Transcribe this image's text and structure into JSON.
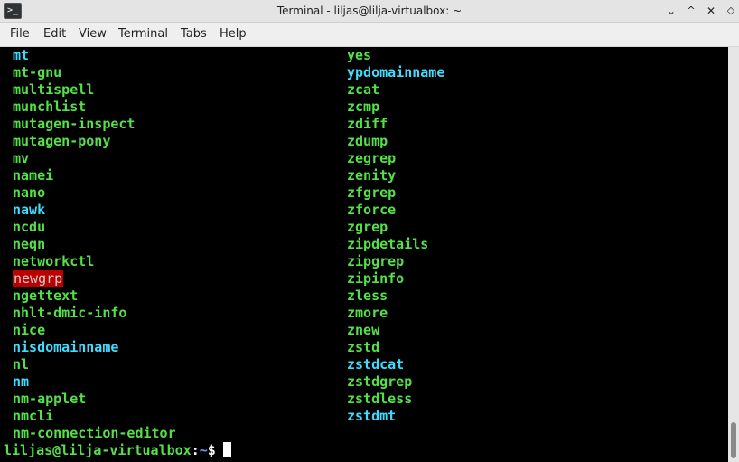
{
  "window": {
    "title": "Terminal - liljas@lilja-virtualbox: ~",
    "app_icon": "terminal-icon",
    "app_icon_glyph": ">_",
    "controls": {
      "minimize": "⌄",
      "maximize": "^",
      "close": "✕",
      "extra": "◇"
    }
  },
  "menu": [
    "File",
    "Edit",
    "View",
    "Terminal",
    "Tabs",
    "Help"
  ],
  "colors": {
    "green": "#55e04a",
    "cyan": "#40dcff",
    "highlight_bg": "#bb0000",
    "path": "#5aa0ff"
  },
  "terminal": {
    "col1": [
      {
        "text": "mt",
        "color": "cyan"
      },
      {
        "text": "mt-gnu",
        "color": "green"
      },
      {
        "text": "multispell",
        "color": "green"
      },
      {
        "text": "munchlist",
        "color": "green"
      },
      {
        "text": "mutagen-inspect",
        "color": "green"
      },
      {
        "text": "mutagen-pony",
        "color": "green"
      },
      {
        "text": "mv",
        "color": "green"
      },
      {
        "text": "namei",
        "color": "green"
      },
      {
        "text": "nano",
        "color": "green"
      },
      {
        "text": "nawk",
        "color": "cyan"
      },
      {
        "text": "ncdu",
        "color": "green"
      },
      {
        "text": "neqn",
        "color": "green"
      },
      {
        "text": "networkctl",
        "color": "green"
      },
      {
        "text": "newgrp",
        "color": "highlight"
      },
      {
        "text": "ngettext",
        "color": "green"
      },
      {
        "text": "nhlt-dmic-info",
        "color": "green"
      },
      {
        "text": "nice",
        "color": "green"
      },
      {
        "text": "nisdomainname",
        "color": "cyan"
      },
      {
        "text": "nl",
        "color": "green"
      },
      {
        "text": "nm",
        "color": "cyan"
      },
      {
        "text": "nm-applet",
        "color": "green"
      },
      {
        "text": "nmcli",
        "color": "green"
      },
      {
        "text": "nm-connection-editor",
        "color": "green"
      }
    ],
    "col2": [
      {
        "text": "yes",
        "color": "green"
      },
      {
        "text": "ypdomainname",
        "color": "cyan"
      },
      {
        "text": "zcat",
        "color": "green"
      },
      {
        "text": "zcmp",
        "color": "green"
      },
      {
        "text": "zdiff",
        "color": "green"
      },
      {
        "text": "zdump",
        "color": "green"
      },
      {
        "text": "zegrep",
        "color": "green"
      },
      {
        "text": "zenity",
        "color": "green"
      },
      {
        "text": "zfgrep",
        "color": "green"
      },
      {
        "text": "zforce",
        "color": "green"
      },
      {
        "text": "zgrep",
        "color": "green"
      },
      {
        "text": "zipdetails",
        "color": "green"
      },
      {
        "text": "zipgrep",
        "color": "green"
      },
      {
        "text": "zipinfo",
        "color": "green"
      },
      {
        "text": "zless",
        "color": "green"
      },
      {
        "text": "zmore",
        "color": "green"
      },
      {
        "text": "znew",
        "color": "green"
      },
      {
        "text": "zstd",
        "color": "green"
      },
      {
        "text": "zstdcat",
        "color": "cyan"
      },
      {
        "text": "zstdgrep",
        "color": "green"
      },
      {
        "text": "zstdless",
        "color": "green"
      },
      {
        "text": "zstdmt",
        "color": "cyan"
      }
    ],
    "prompt": {
      "user_host": "liljas@lilja-virtualbox",
      "colon": ":",
      "path": "~",
      "symbol": "$"
    }
  }
}
